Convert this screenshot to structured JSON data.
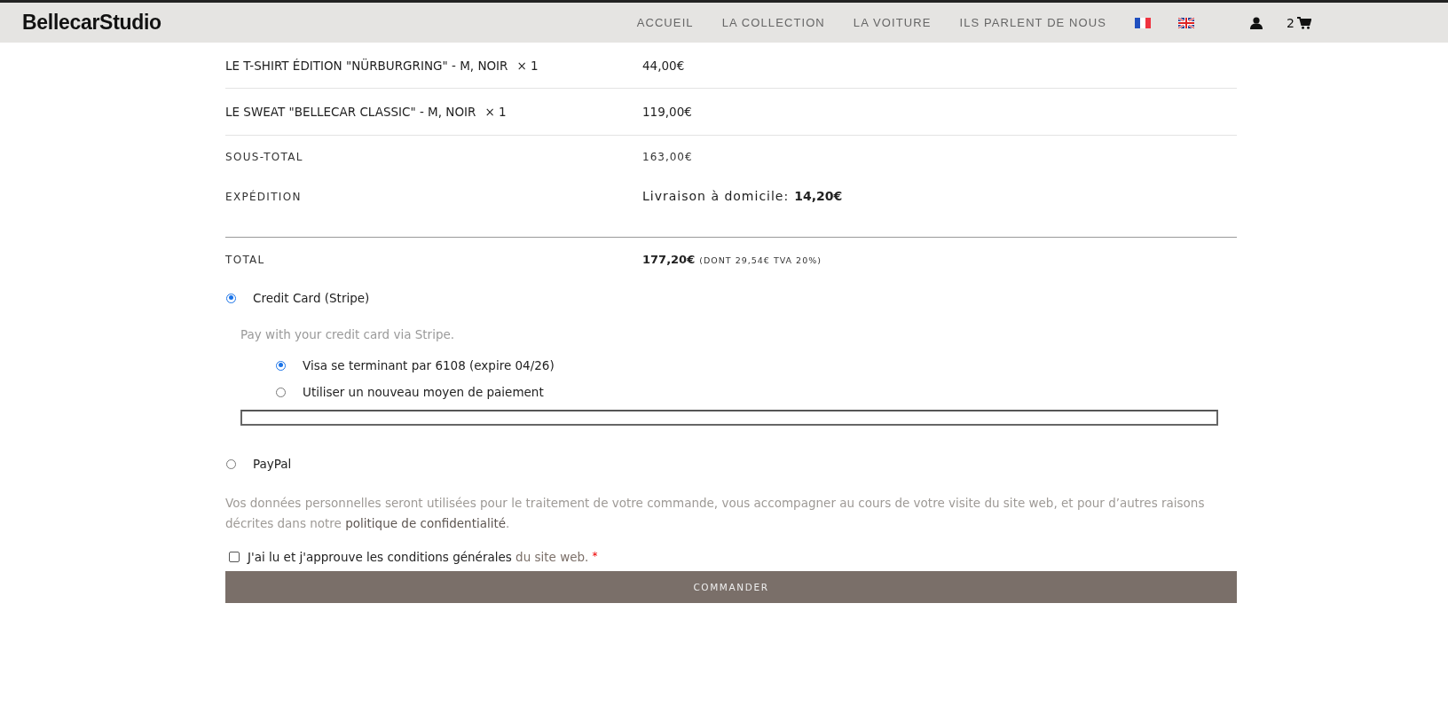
{
  "header": {
    "logo": "BellecarStudio",
    "nav": [
      {
        "label": "ACCUEIL"
      },
      {
        "label": "LA COLLECTION"
      },
      {
        "label": "LA VOITURE"
      },
      {
        "label": "ILS PARLENT DE NOUS"
      }
    ],
    "languages": [
      {
        "kind": "fr"
      },
      {
        "kind": "uk"
      }
    ],
    "cart_count": "2"
  },
  "order": {
    "items": [
      {
        "name": "LE T-SHIRT ÉDITION \"NÜRBURGRING\" - M, NOIR",
        "quantity": "× 1",
        "price": "44,00€"
      },
      {
        "name": "LE SWEAT \"BELLECAR CLASSIC\" - M, NOIR",
        "quantity": "× 1",
        "price": "119,00€"
      }
    ],
    "subtotal": {
      "label": "SOUS-TOTAL",
      "value": "163,00€"
    },
    "shipping": {
      "label": "EXPÉDITION",
      "method": "Livraison à domicile:",
      "value": "14,20€"
    },
    "total": {
      "label": "TOTAL",
      "value": "177,20€",
      "tax_note": "(DONT 29,54€ TVA 20%)"
    }
  },
  "payment": {
    "methods": [
      {
        "label": "Credit Card (Stripe)",
        "selected": true,
        "description": "Pay with your credit card via Stripe.",
        "cards": [
          {
            "label": "Visa se terminant par 6108 (expire 04/26)",
            "selected": true
          },
          {
            "label": "Utiliser un nouveau moyen de paiement",
            "selected": false
          }
        ]
      },
      {
        "label": "PayPal",
        "selected": false
      }
    ]
  },
  "privacy": {
    "text": "Vos données personnelles seront utilisées pour le traitement de votre commande, vous accompagner au cours de votre visite du site web, et pour d’autres raisons décrites dans notre",
    "link": "politique de confidentialité",
    "end": "."
  },
  "terms": {
    "checked": false,
    "text": "J'ai lu et j'approuve les conditions générales",
    "link": "du site web.",
    "required": "*"
  },
  "submit": "COMMANDER"
}
